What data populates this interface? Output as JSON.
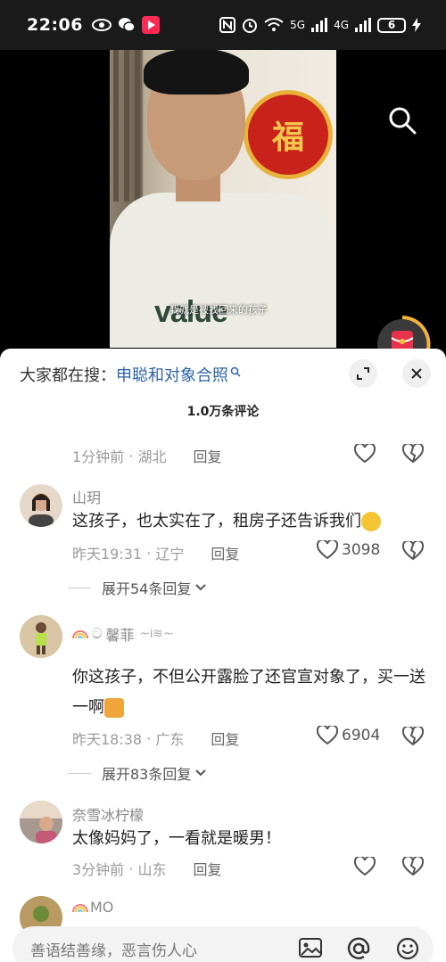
{
  "status_bar": {
    "time": "22:06",
    "network": "5G",
    "network2": "4G",
    "battery": "6"
  },
  "video": {
    "subtitle": "我就是被找回来的孩子",
    "shirt_text": "value",
    "decoration_char": "福"
  },
  "search_tip": {
    "label": "大家都在搜：",
    "query": "申聪和对象合照"
  },
  "comment_count": "1.0万条评论",
  "top_meta": {
    "time": "1分钟前",
    "location": "湖北",
    "reply": "回复"
  },
  "comments": [
    {
      "username": "山玥",
      "text": "这孩子，也太实在了，租房子还告诉我们",
      "time": "昨天19:31",
      "location": "辽宁",
      "reply": "回复",
      "likes": "3098",
      "expand": "展开54条回复"
    },
    {
      "username": "馨菲",
      "text": "你这孩子，不但公开露脸了还官宣对象了，买一送一啊",
      "time": "昨天18:38",
      "location": "广东",
      "reply": "回复",
      "likes": "6904",
      "expand": "展开83条回复"
    },
    {
      "username": "奈雪冰柠檬",
      "text": "太像妈妈了，一看就是暖男！",
      "time": "3分钟前",
      "location": "山东",
      "reply": "回复"
    },
    {
      "username": "MO"
    }
  ],
  "input": {
    "placeholder": "善语结善缘，恶言伤人心"
  },
  "colors": {
    "accent_blue": "#2d63a8",
    "red_packet": "#e8334a"
  }
}
